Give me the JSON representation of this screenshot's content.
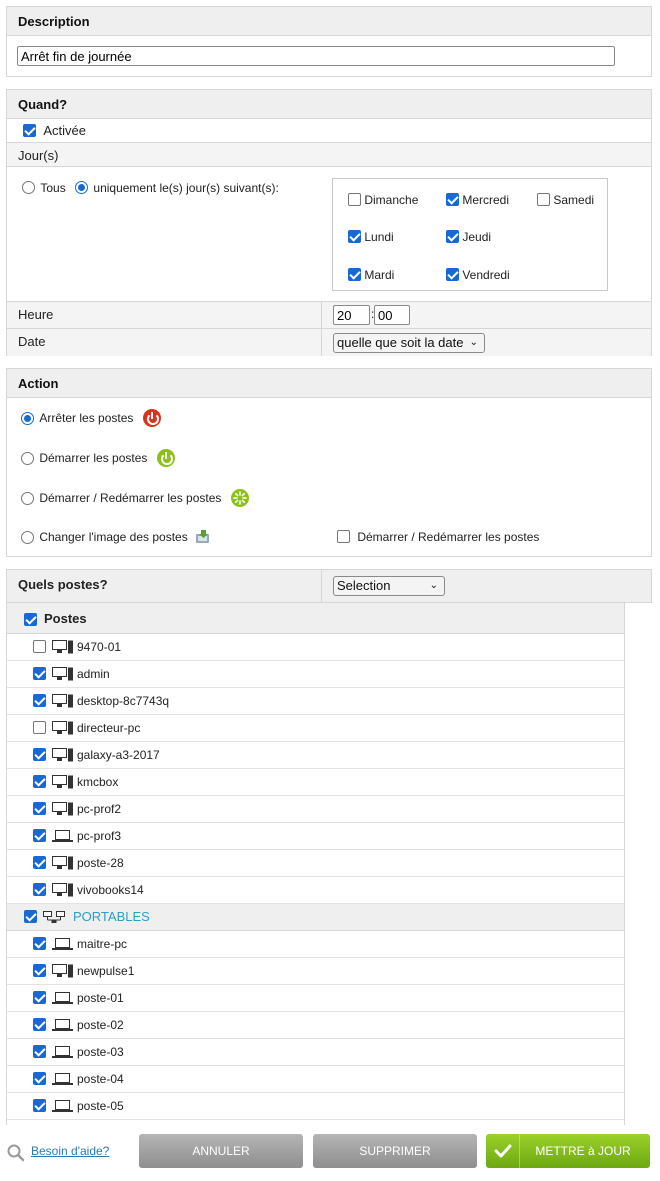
{
  "description": {
    "header": "Description",
    "value": "Arrêt fin de journée"
  },
  "quand": {
    "header": "Quand?",
    "active_label": "Activée",
    "active_checked": true,
    "jours_label": "Jour(s)",
    "mode_tous": "Tous",
    "mode_specific": "uniquement le(s) jour(s) suivant(s):",
    "days": [
      {
        "label": "Dimanche",
        "checked": false
      },
      {
        "label": "Mercredi",
        "checked": true
      },
      {
        "label": "Samedi",
        "checked": false
      },
      {
        "label": "Lundi",
        "checked": true
      },
      {
        "label": "Jeudi",
        "checked": true
      },
      {
        "label": "Mardi",
        "checked": true
      },
      {
        "label": "Vendredi",
        "checked": true
      }
    ],
    "heure_label": "Heure",
    "hour": "20",
    "minute": "00",
    "time_sep": ":",
    "date_label": "Date",
    "date_value": "quelle que soit la date"
  },
  "action": {
    "header": "Action",
    "options": [
      {
        "label": "Arrêter les postes",
        "icon": "power-red-icon",
        "selected": true
      },
      {
        "label": "Démarrer les postes",
        "icon": "power-green-icon",
        "selected": false
      },
      {
        "label": "Démarrer / Redémarrer les postes",
        "icon": "spark-icon",
        "selected": false
      },
      {
        "label": "Changer l'image des postes",
        "icon": "disk-image-icon",
        "selected": false
      }
    ],
    "extra_checkbox_label": "Démarrer / Redémarrer les postes"
  },
  "postes": {
    "header": "Quels postes?",
    "select_value": "Selection",
    "groups": [
      {
        "name": "Postes",
        "checked": true,
        "items": [
          {
            "name": "9470-01",
            "checked": false,
            "type": "desktop"
          },
          {
            "name": "admin",
            "checked": true,
            "type": "desktop"
          },
          {
            "name": "desktop-8c7743q",
            "checked": true,
            "type": "desktop"
          },
          {
            "name": "directeur-pc",
            "checked": false,
            "type": "desktop"
          },
          {
            "name": "galaxy-a3-2017",
            "checked": true,
            "type": "desktop"
          },
          {
            "name": "kmcbox",
            "checked": true,
            "type": "desktop"
          },
          {
            "name": "pc-prof2",
            "checked": true,
            "type": "desktop"
          },
          {
            "name": "pc-prof3",
            "checked": true,
            "type": "laptop"
          },
          {
            "name": "poste-28",
            "checked": true,
            "type": "desktop"
          },
          {
            "name": "vivobooks14",
            "checked": true,
            "type": "desktop"
          }
        ]
      },
      {
        "name": "PORTABLES",
        "checked": true,
        "items": [
          {
            "name": "maitre-pc",
            "checked": true,
            "type": "laptop"
          },
          {
            "name": "newpulse1",
            "checked": true,
            "type": "desktop"
          },
          {
            "name": "poste-01",
            "checked": true,
            "type": "laptop"
          },
          {
            "name": "poste-02",
            "checked": true,
            "type": "laptop"
          },
          {
            "name": "poste-03",
            "checked": true,
            "type": "laptop"
          },
          {
            "name": "poste-04",
            "checked": true,
            "type": "laptop"
          },
          {
            "name": "poste-05",
            "checked": true,
            "type": "laptop"
          }
        ]
      }
    ]
  },
  "footer": {
    "help": "Besoin d'aide?",
    "cancel": "ANNULER",
    "delete": "SUPPRIMER",
    "update": "METTRE à JOUR"
  },
  "colors": {
    "accent": "#1769d6",
    "group_link": "#2aa0c8",
    "button_green": "#7fb91b"
  }
}
